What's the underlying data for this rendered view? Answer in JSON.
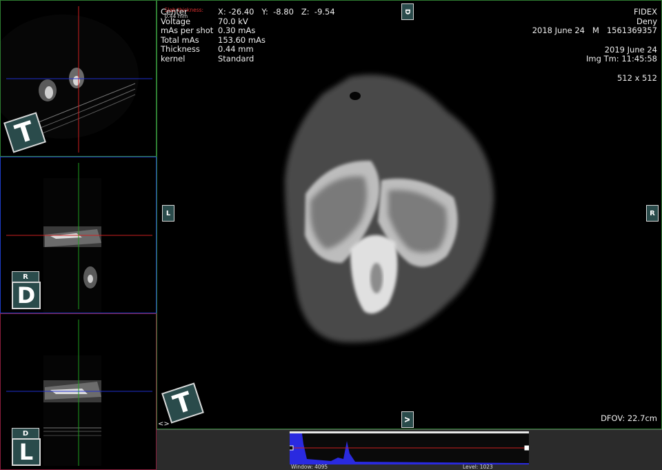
{
  "header": {
    "slab_label": "Slab thickness:",
    "slab_value": "0.44 mm"
  },
  "info_left": {
    "rows": [
      {
        "label": "Center",
        "value": "X: -26.40   Y:  -8.80   Z:  -9.54"
      },
      {
        "label": "Voltage",
        "value": "70.0 kV"
      },
      {
        "label": "mAs per shot",
        "value": "0.30 mAs"
      },
      {
        "label": "Total mAs",
        "value": "153.60 mAs"
      },
      {
        "label": "Thickness",
        "value": "0.44 mm"
      },
      {
        "label": "kernel",
        "value": "Standard"
      }
    ]
  },
  "info_right": {
    "institution": "FIDEX",
    "patient": "Deny",
    "birth_sex_id": "2018 June 24   M   1561369357",
    "study_date": "2019 June 24",
    "img_time": "Img Tm: 11:45:58",
    "matrix": "512 x 512"
  },
  "footer": {
    "dfov": "DFOV: 22.7cm",
    "nav_arrows": "<>"
  },
  "histogram": {
    "window_label": "Window: 4095",
    "level_label": "Level: 1023"
  },
  "orientation": {
    "main": "T",
    "top_marker": "D",
    "left_marker": "L",
    "right_marker": "R",
    "bottom_marker": "V",
    "thumb_axial": "T",
    "thumb_coronal": "R",
    "thumb_coronal_big": "D",
    "thumb_sagittal_top": "D",
    "thumb_sagittal_big": "L"
  },
  "colors": {
    "axial_frame": "#2e7d32",
    "coronal_frame": "#1e3cc8",
    "sagittal_frame": "#8a1e3c",
    "main_frame": "#2e7d32",
    "histogram_fill": "#2a2ae0"
  }
}
